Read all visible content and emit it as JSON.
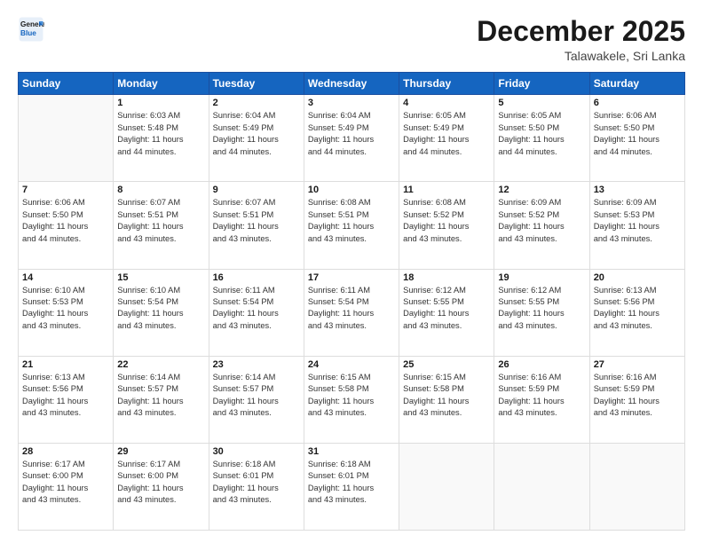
{
  "logo": {
    "line1": "General",
    "line2": "Blue"
  },
  "title": "December 2025",
  "location": "Talawakele, Sri Lanka",
  "header_days": [
    "Sunday",
    "Monday",
    "Tuesday",
    "Wednesday",
    "Thursday",
    "Friday",
    "Saturday"
  ],
  "weeks": [
    [
      {
        "day": "",
        "lines": []
      },
      {
        "day": "1",
        "lines": [
          "Sunrise: 6:03 AM",
          "Sunset: 5:48 PM",
          "Daylight: 11 hours",
          "and 44 minutes."
        ]
      },
      {
        "day": "2",
        "lines": [
          "Sunrise: 6:04 AM",
          "Sunset: 5:49 PM",
          "Daylight: 11 hours",
          "and 44 minutes."
        ]
      },
      {
        "day": "3",
        "lines": [
          "Sunrise: 6:04 AM",
          "Sunset: 5:49 PM",
          "Daylight: 11 hours",
          "and 44 minutes."
        ]
      },
      {
        "day": "4",
        "lines": [
          "Sunrise: 6:05 AM",
          "Sunset: 5:49 PM",
          "Daylight: 11 hours",
          "and 44 minutes."
        ]
      },
      {
        "day": "5",
        "lines": [
          "Sunrise: 6:05 AM",
          "Sunset: 5:50 PM",
          "Daylight: 11 hours",
          "and 44 minutes."
        ]
      },
      {
        "day": "6",
        "lines": [
          "Sunrise: 6:06 AM",
          "Sunset: 5:50 PM",
          "Daylight: 11 hours",
          "and 44 minutes."
        ]
      }
    ],
    [
      {
        "day": "7",
        "lines": [
          "Sunrise: 6:06 AM",
          "Sunset: 5:50 PM",
          "Daylight: 11 hours",
          "and 44 minutes."
        ]
      },
      {
        "day": "8",
        "lines": [
          "Sunrise: 6:07 AM",
          "Sunset: 5:51 PM",
          "Daylight: 11 hours",
          "and 43 minutes."
        ]
      },
      {
        "day": "9",
        "lines": [
          "Sunrise: 6:07 AM",
          "Sunset: 5:51 PM",
          "Daylight: 11 hours",
          "and 43 minutes."
        ]
      },
      {
        "day": "10",
        "lines": [
          "Sunrise: 6:08 AM",
          "Sunset: 5:51 PM",
          "Daylight: 11 hours",
          "and 43 minutes."
        ]
      },
      {
        "day": "11",
        "lines": [
          "Sunrise: 6:08 AM",
          "Sunset: 5:52 PM",
          "Daylight: 11 hours",
          "and 43 minutes."
        ]
      },
      {
        "day": "12",
        "lines": [
          "Sunrise: 6:09 AM",
          "Sunset: 5:52 PM",
          "Daylight: 11 hours",
          "and 43 minutes."
        ]
      },
      {
        "day": "13",
        "lines": [
          "Sunrise: 6:09 AM",
          "Sunset: 5:53 PM",
          "Daylight: 11 hours",
          "and 43 minutes."
        ]
      }
    ],
    [
      {
        "day": "14",
        "lines": [
          "Sunrise: 6:10 AM",
          "Sunset: 5:53 PM",
          "Daylight: 11 hours",
          "and 43 minutes."
        ]
      },
      {
        "day": "15",
        "lines": [
          "Sunrise: 6:10 AM",
          "Sunset: 5:54 PM",
          "Daylight: 11 hours",
          "and 43 minutes."
        ]
      },
      {
        "day": "16",
        "lines": [
          "Sunrise: 6:11 AM",
          "Sunset: 5:54 PM",
          "Daylight: 11 hours",
          "and 43 minutes."
        ]
      },
      {
        "day": "17",
        "lines": [
          "Sunrise: 6:11 AM",
          "Sunset: 5:54 PM",
          "Daylight: 11 hours",
          "and 43 minutes."
        ]
      },
      {
        "day": "18",
        "lines": [
          "Sunrise: 6:12 AM",
          "Sunset: 5:55 PM",
          "Daylight: 11 hours",
          "and 43 minutes."
        ]
      },
      {
        "day": "19",
        "lines": [
          "Sunrise: 6:12 AM",
          "Sunset: 5:55 PM",
          "Daylight: 11 hours",
          "and 43 minutes."
        ]
      },
      {
        "day": "20",
        "lines": [
          "Sunrise: 6:13 AM",
          "Sunset: 5:56 PM",
          "Daylight: 11 hours",
          "and 43 minutes."
        ]
      }
    ],
    [
      {
        "day": "21",
        "lines": [
          "Sunrise: 6:13 AM",
          "Sunset: 5:56 PM",
          "Daylight: 11 hours",
          "and 43 minutes."
        ]
      },
      {
        "day": "22",
        "lines": [
          "Sunrise: 6:14 AM",
          "Sunset: 5:57 PM",
          "Daylight: 11 hours",
          "and 43 minutes."
        ]
      },
      {
        "day": "23",
        "lines": [
          "Sunrise: 6:14 AM",
          "Sunset: 5:57 PM",
          "Daylight: 11 hours",
          "and 43 minutes."
        ]
      },
      {
        "day": "24",
        "lines": [
          "Sunrise: 6:15 AM",
          "Sunset: 5:58 PM",
          "Daylight: 11 hours",
          "and 43 minutes."
        ]
      },
      {
        "day": "25",
        "lines": [
          "Sunrise: 6:15 AM",
          "Sunset: 5:58 PM",
          "Daylight: 11 hours",
          "and 43 minutes."
        ]
      },
      {
        "day": "26",
        "lines": [
          "Sunrise: 6:16 AM",
          "Sunset: 5:59 PM",
          "Daylight: 11 hours",
          "and 43 minutes."
        ]
      },
      {
        "day": "27",
        "lines": [
          "Sunrise: 6:16 AM",
          "Sunset: 5:59 PM",
          "Daylight: 11 hours",
          "and 43 minutes."
        ]
      }
    ],
    [
      {
        "day": "28",
        "lines": [
          "Sunrise: 6:17 AM",
          "Sunset: 6:00 PM",
          "Daylight: 11 hours",
          "and 43 minutes."
        ]
      },
      {
        "day": "29",
        "lines": [
          "Sunrise: 6:17 AM",
          "Sunset: 6:00 PM",
          "Daylight: 11 hours",
          "and 43 minutes."
        ]
      },
      {
        "day": "30",
        "lines": [
          "Sunrise: 6:18 AM",
          "Sunset: 6:01 PM",
          "Daylight: 11 hours",
          "and 43 minutes."
        ]
      },
      {
        "day": "31",
        "lines": [
          "Sunrise: 6:18 AM",
          "Sunset: 6:01 PM",
          "Daylight: 11 hours",
          "and 43 minutes."
        ]
      },
      {
        "day": "",
        "lines": []
      },
      {
        "day": "",
        "lines": []
      },
      {
        "day": "",
        "lines": []
      }
    ]
  ]
}
